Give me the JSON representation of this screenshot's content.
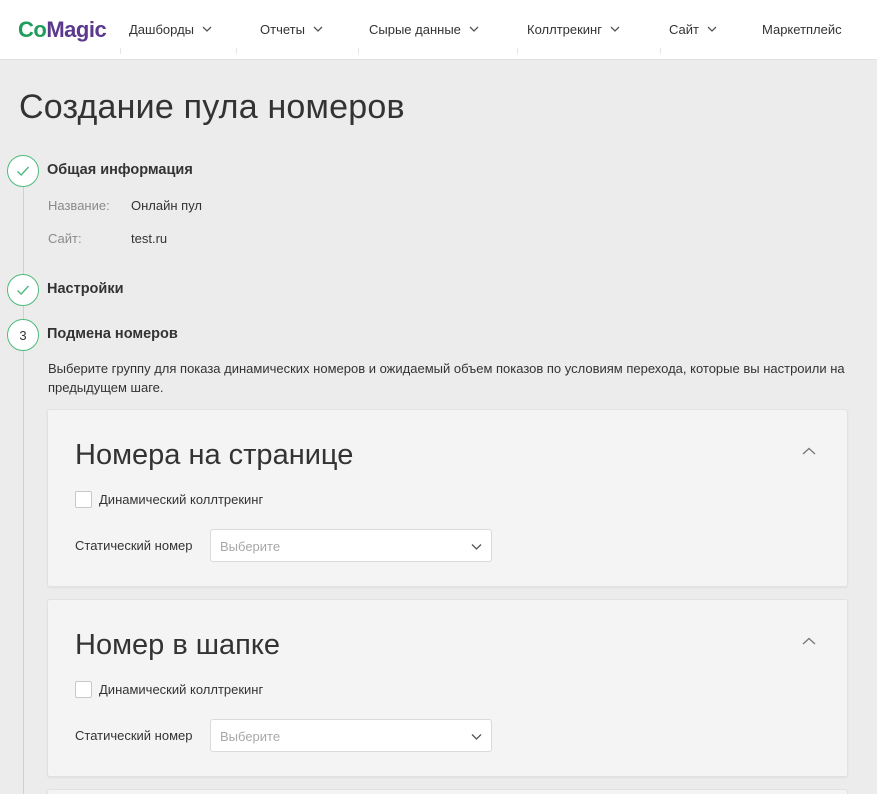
{
  "brand": {
    "logo_part1": "Co",
    "logo_part2": "Magic"
  },
  "nav": {
    "items": [
      {
        "label": "Дашборды",
        "has_dropdown": true
      },
      {
        "label": "Отчеты",
        "has_dropdown": true
      },
      {
        "label": "Сырые данные",
        "has_dropdown": true
      },
      {
        "label": "Коллтрекинг",
        "has_dropdown": true
      },
      {
        "label": "Сайт",
        "has_dropdown": true
      },
      {
        "label": "Маркетплейс",
        "has_dropdown": false
      }
    ]
  },
  "page": {
    "title": "Создание пула номеров"
  },
  "steps": {
    "general": {
      "title": "Общая информация",
      "status": "completed",
      "fields": [
        {
          "label": "Название:",
          "value": "Онлайн пул"
        },
        {
          "label": "Сайт:",
          "value": "test.ru"
        }
      ]
    },
    "settings": {
      "title": "Настройки",
      "status": "completed"
    },
    "substitution": {
      "number": "3",
      "title": "Подмена номеров",
      "status": "active",
      "description": "Выберите группу для показа динамических номеров и ожидаемый объем показов по условиям перехода, которые вы настроили на предыдущем шаге."
    }
  },
  "cards": [
    {
      "title": "Номера на странице",
      "dynamic_label": "Динамический коллтрекинг",
      "dynamic_checked": false,
      "static_label": "Статический номер",
      "static_placeholder": "Выберите"
    },
    {
      "title": "Номер в шапке",
      "dynamic_label": "Динамический коллтрекинг",
      "dynamic_checked": false,
      "static_label": "Статический номер",
      "static_placeholder": "Выберите"
    }
  ],
  "colors": {
    "accent_green": "#4dbb7c",
    "logo_green": "#1e9e5a",
    "logo_purple": "#5b3a8e",
    "background": "#ececec"
  }
}
